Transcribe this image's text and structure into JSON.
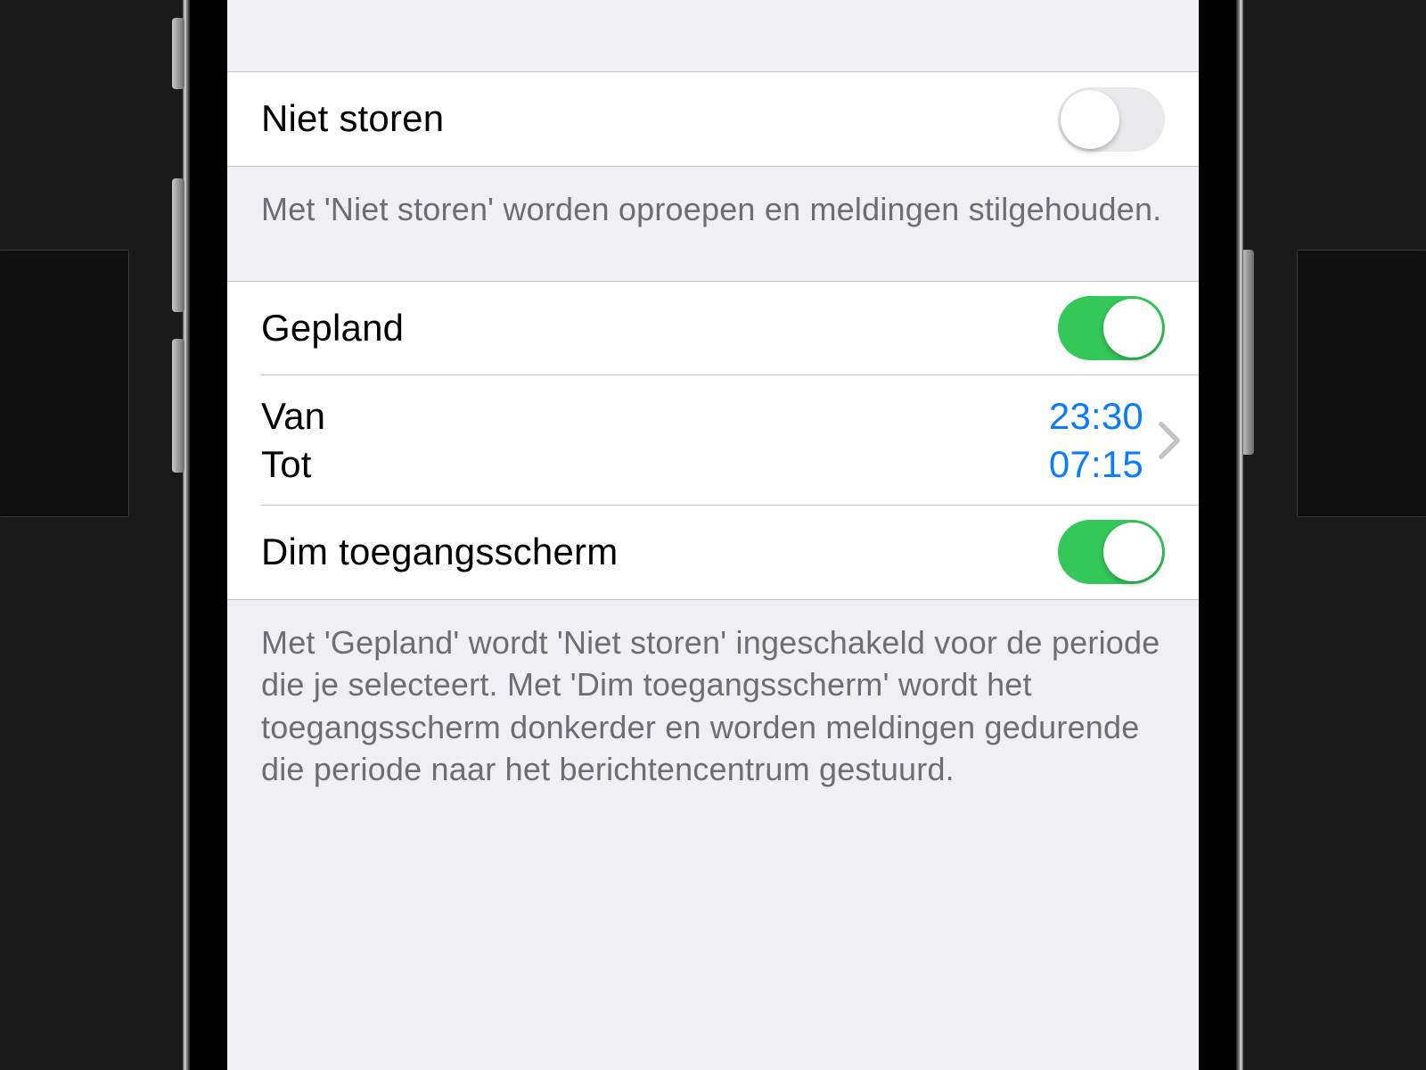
{
  "dnd": {
    "label": "Niet storen",
    "enabled": false,
    "description": "Met 'Niet storen' worden oproepen en meldingen stilgehouden."
  },
  "scheduled": {
    "label": "Gepland",
    "enabled": true,
    "from_label": "Van",
    "to_label": "Tot",
    "from_time": "23:30",
    "to_time": "07:15"
  },
  "dim_lock": {
    "label": "Dim toegangsscherm",
    "enabled": true
  },
  "scheduled_description": "Met 'Gepland' wordt 'Niet storen' ingeschakeld voor de periode die je selecteert. Met 'Dim toegangsscherm' wordt het toegangsscherm donkerder en worden meldingen gedurende die periode naar het berichtencentrum gestuurd."
}
